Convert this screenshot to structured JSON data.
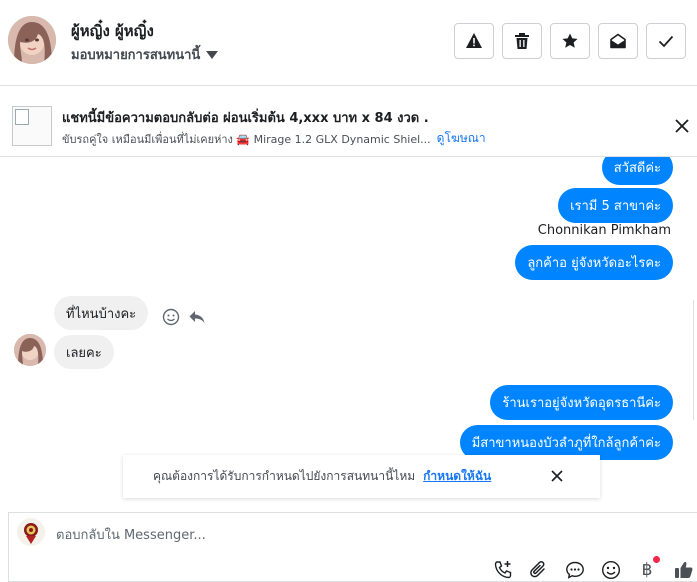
{
  "header": {
    "user_name": "ผู้หญิ๋ง ผู้หญิ๋ง",
    "assign_label": "มอบหมายการสนทนานี้",
    "actions": [
      {
        "icon": "warning-icon"
      },
      {
        "icon": "trash-icon"
      },
      {
        "icon": "star-icon"
      },
      {
        "icon": "mark-unread-icon"
      },
      {
        "icon": "check-icon"
      }
    ]
  },
  "ad": {
    "title": "แชทนี้มีข้อความตอบกลับต่อ ผ่อนเริ่มต้น 4,xxx บาท x 84 งวด .",
    "subtitle": "ขับรถคู่ใจ เหมือนมีเพื่อนที่ไม่เคยห่าง 🚘 Mirage 1.2 GLX Dynamic Shiel...",
    "link": "ดูโฆษณา"
  },
  "messages": {
    "out_1": "สวัสดีค่ะ",
    "out_2": "เรามี 5 สาขาค่ะ",
    "sender": "Chonnikan Pimkham",
    "out_3": "ลูกค้าอ ยู่จังหวัดอะไรคะ",
    "in_1": "ที่ไหนบ้างคะ",
    "in_2": "เลยคะ",
    "out_4": "ร้านเราอยู่จังหวัดอุดรธานีค่ะ",
    "out_5": "มีสาขาหนองบัวลำภูที่ใกล้ลูกค้าค่ะ"
  },
  "toast": {
    "text": "คุณต้องการได้รับการกำหนดไปยังการสนทนานี้ไหม",
    "link": "กำหนดให้ฉัน"
  },
  "composer": {
    "placeholder": "ตอบกลับใน Messenger...",
    "baht_symbol": "฿",
    "tools": [
      "call-add-icon",
      "attachment-icon",
      "saved-reply-icon",
      "emoji-icon",
      "payment-icon",
      "like-icon"
    ]
  },
  "colors": {
    "accent": "#0084ff",
    "link": "#1877f2",
    "incoming_bubble": "#f0f0f0"
  }
}
